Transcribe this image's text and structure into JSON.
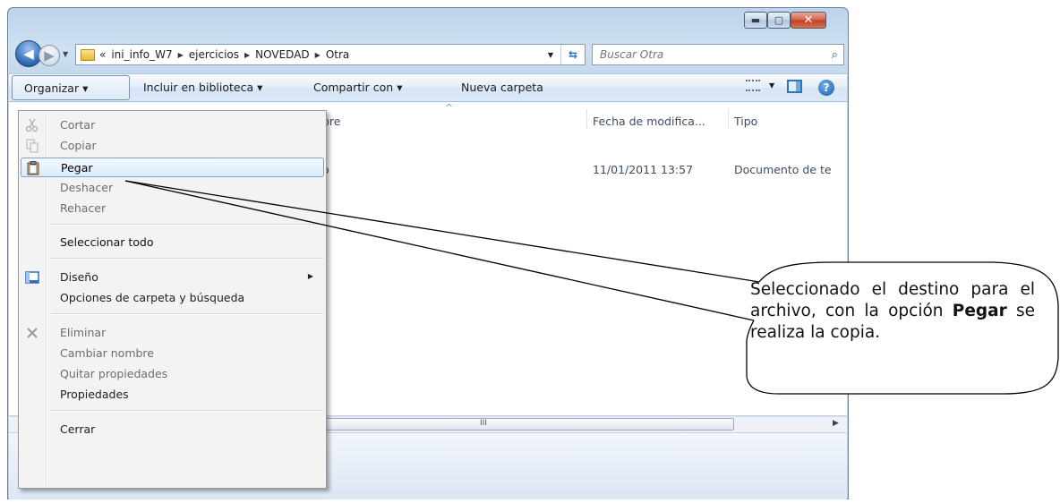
{
  "address": {
    "overflow": "«",
    "crumbs": [
      "ini_info_W7",
      "ejercicios",
      "NOVEDAD",
      "Otra"
    ]
  },
  "search": {
    "placeholder": "Buscar Otra"
  },
  "toolbar": {
    "organize": "Organizar ▾",
    "include": "Incluir en biblioteca ▾",
    "share": "Compartir con ▾",
    "new_folder": "Nueva carpeta"
  },
  "columns": {
    "name_partial": "bre",
    "date": "Fecha de modifica...",
    "type": "Tipo"
  },
  "file_row": {
    "name_partial": "o",
    "date": "11/01/2011 13:57",
    "type": "Documento de te"
  },
  "scrollbar": {
    "grip": "III"
  },
  "menu": {
    "cut": "Cortar",
    "copy": "Copiar",
    "paste": "Pegar",
    "undo": "Deshacer",
    "redo": "Rehacer",
    "select_all": "Seleccionar todo",
    "layout": "Diseño",
    "folder_options": "Opciones de carpeta y búsqueda",
    "delete": "Eliminar",
    "rename": "Cambiar nombre",
    "remove_props": "Quitar propiedades",
    "properties": "Propiedades",
    "close": "Cerrar"
  },
  "callout": {
    "text_before": "Seleccionado el destino para el archivo, con la opción ",
    "bold": "Pegar",
    "text_after": " se realiza la copia."
  },
  "icons": {
    "minimize": "minimize-icon",
    "maximize": "maximize-icon",
    "close": "close-icon",
    "back": "back-arrow-icon",
    "forward": "forward-arrow-icon",
    "folder": "folder-icon",
    "refresh": "refresh-icon",
    "search": "magnifier-icon",
    "view": "view-options-icon",
    "preview_pane": "preview-pane-icon",
    "help": "help-icon",
    "scissors": "scissors-icon",
    "copy": "copy-icon",
    "paste": "clipboard-icon",
    "layout": "layout-icon",
    "delete": "delete-x-icon"
  },
  "colors": {
    "window_frame": "#c9dcf0",
    "highlight_border": "#7da2ce",
    "close_button": "#d4604a"
  }
}
